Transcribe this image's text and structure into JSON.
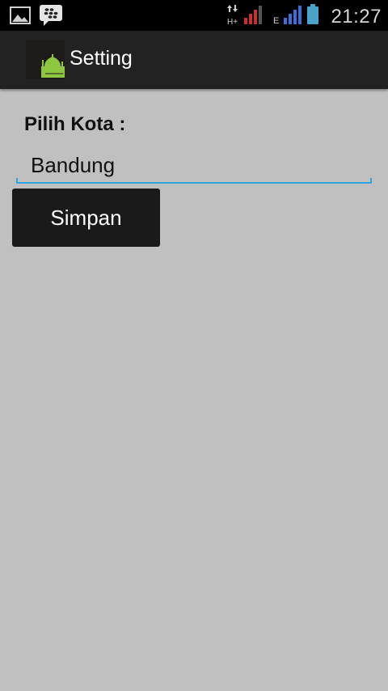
{
  "status_bar": {
    "left_icons": [
      "image-notification-icon",
      "blackberry-messenger-icon"
    ],
    "right_icons": [
      "data-transfer-icon",
      "signal-bars-red-icon",
      "signal-bars-blue-icon",
      "battery-icon"
    ],
    "network_type_1": "H+",
    "network_type_2": "E",
    "clock": "21:27"
  },
  "action_bar": {
    "app_icon": "mosque-icon",
    "title": "Setting"
  },
  "form": {
    "city_label": "Pilih Kota :",
    "city_value": "Bandung",
    "save_label": "Simpan"
  },
  "colors": {
    "background": "#c0c0c0",
    "action_bar": "#222222",
    "status_bar": "#000000",
    "input_underline": "#2fa6d8",
    "button": "#1a1a1a",
    "icon_green": "#8dc63f"
  }
}
